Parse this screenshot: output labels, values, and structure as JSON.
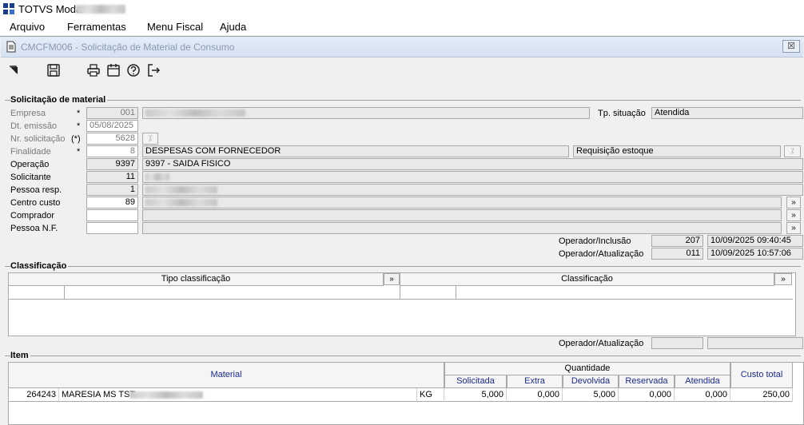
{
  "app": {
    "title": "TOTVS Moda"
  },
  "menu": [
    "Arquivo",
    "Ferramentas",
    "Menu Fiscal",
    "Ajuda"
  ],
  "child": {
    "title": "CMCFM006 - Solicitação de Material de Consumo",
    "close_label": "☒"
  },
  "sections": {
    "solicitacao": "Solicitação de material",
    "classificacao": "Classificação",
    "item": "Item"
  },
  "labels": {
    "empresa": "Empresa",
    "dt_emissao": "Dt. emissão",
    "nr_solicitacao": "Nr. solicitação",
    "finalidade": "Finalidade",
    "operacao": "Operação",
    "solicitante": "Solicitante",
    "pessoa_resp": "Pessoa resp.",
    "centro_custo": "Centro custo",
    "comprador": "Comprador",
    "pessoa_nf": "Pessoa N.F.",
    "tp_situacao": "Tp. situação",
    "operador_inclusao": "Operador/Inclusão",
    "operador_atualizacao": "Operador/Atualização",
    "class_operador_atualizacao": "Operador/Atualização"
  },
  "markers": {
    "star": "*",
    "paren_star": "(*)"
  },
  "fields": {
    "empresa": "001",
    "dt_emissao": "05/08/2025",
    "nr_solicitacao": "5628",
    "finalidade_code": "8",
    "finalidade_desc": "DESPESAS COM FORNECEDOR",
    "finalidade_extra": "Requisição estoque",
    "operacao_code": "9397",
    "operacao_desc": "9397 - SAIDA FISICO",
    "solicitante_code": "11",
    "pessoa_resp_code": "1",
    "centro_custo_code": "89",
    "tp_situacao": "Atendida",
    "op_inclusao_code": "207",
    "op_inclusao_date": "10/09/2025 09:40:45",
    "op_atualizacao_code": "011",
    "op_atualizacao_date": "10/09/2025 10:57:06"
  },
  "buttons": {
    "lookup_glyph": "»"
  },
  "classificacao": {
    "col_tipo": "Tipo classificação",
    "col_class": "Classificação"
  },
  "item": {
    "col_material": "Material",
    "col_quantidade": "Quantidade",
    "col_custo_total": "Custo total",
    "sub_cols": [
      "Solicitada",
      "Extra",
      "Devolvida",
      "Reservada",
      "Atendida"
    ],
    "rows": [
      {
        "code": "264243",
        "name": "MARESIA MS TST",
        "unit": "KG",
        "solicitada": "5,000",
        "extra": "0,000",
        "devolvida": "5,000",
        "reservada": "0,000",
        "atendida": "0,000",
        "custo_total": "250,00"
      }
    ]
  }
}
